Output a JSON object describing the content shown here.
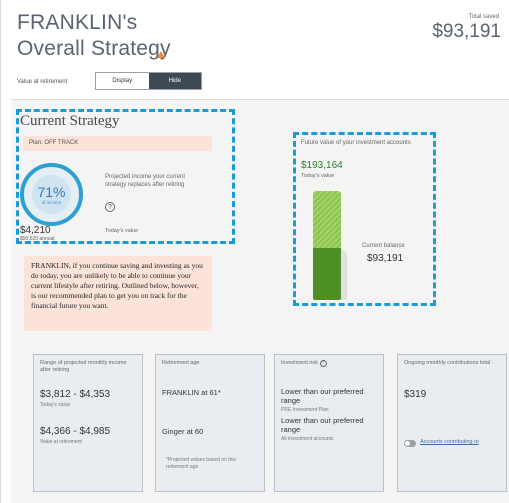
{
  "header": {
    "title_line1": "FRANKLIN's",
    "title_line2": "Overall Strategy",
    "warning_icon": "warning-triangle-icon",
    "total_saved_label": "Total saved",
    "total_saved_value": "$93,191"
  },
  "view_toggle": {
    "label": "Value at retirement",
    "display_label": "Display",
    "hide_label": "Hide",
    "selected": "Hide"
  },
  "current_strategy": {
    "title": "Current Strategy",
    "plan_status": "Plan: OFF TRACK",
    "ring_percent": "71%",
    "ring_percent_value": 71,
    "ring_caption": "of income",
    "projected_text": "Projected income your current strategy replaces after retiring",
    "help_icon": "question-circle-icon",
    "monthly_amount": "$4,210",
    "annual_amount": "$50,520 annual",
    "today_value_label": "Today's value"
  },
  "future_value": {
    "label": "Future value of your investment accounts",
    "value": "$193,164",
    "today_label": "Today's value",
    "current_balance_label": "Current balance",
    "current_balance_value": "$93,191",
    "future_value_number": 193164,
    "current_balance_number": 93191
  },
  "message": "FRANKLIN, if you continue saving and investing as you do today, you are unlikely to be able to continue your current lifestyle after retiring. Outlined below, however, is our recommended plan to get you on track for the financial future you want.",
  "cards": {
    "income_range": {
      "header": "Range of projected monthly income after retiring",
      "range_today": "$3,812 - $4,353",
      "today_label": "Today's value",
      "range_retirement": "$4,366 - $4,985",
      "retirement_label": "Value at retirement"
    },
    "retirement_age": {
      "header": "Retirement age",
      "person1": "FRANKLIN at 61*",
      "person2": "Ginger at 60",
      "footnote": "*Projected values based on this retirement age"
    },
    "investment_risk": {
      "header": "Investment risk",
      "risk1": "Lower than our preferred range",
      "risk1_sub": "PRE Investment Plan",
      "risk2": "Lower than our preferred range",
      "risk2_sub": "All investment accounts"
    },
    "contributions": {
      "header": "Ongoing monthly contributions total",
      "amount": "$319",
      "link": "Accounts contributing to"
    }
  }
}
